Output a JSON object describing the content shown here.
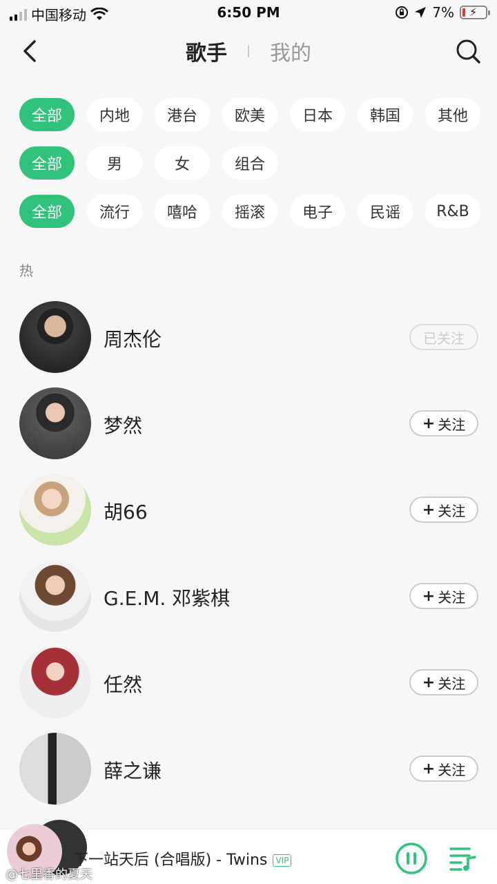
{
  "status_bar": {
    "carrier": "中国移动",
    "time": "6:50 PM",
    "battery": "7%"
  },
  "nav": {
    "tab_active": "歌手",
    "tab_inactive": "我的"
  },
  "filters": {
    "region": [
      "全部",
      "内地",
      "港台",
      "欧美",
      "日本",
      "韩国",
      "其他"
    ],
    "gender": [
      "全部",
      "男",
      "女",
      "组合"
    ],
    "genre": [
      "全部",
      "流行",
      "嘻哈",
      "摇滚",
      "电子",
      "民谣",
      "R&B"
    ]
  },
  "section_label": "热",
  "artists": [
    {
      "name": "周杰伦",
      "follow": "已关注",
      "followed": true
    },
    {
      "name": "梦然",
      "follow": "关注",
      "followed": false
    },
    {
      "name": "胡66",
      "follow": "关注",
      "followed": false
    },
    {
      "name": "G.E.M. 邓紫棋",
      "follow": "关注",
      "followed": false
    },
    {
      "name": "任然",
      "follow": "关注",
      "followed": false
    },
    {
      "name": "薛之谦",
      "follow": "关注",
      "followed": false
    }
  ],
  "player": {
    "title": "下一站天后 (合唱版) - Twins",
    "badge": "VIP"
  },
  "watermark": "@七里香的夏天",
  "colors": {
    "accent": "#31c27c"
  }
}
